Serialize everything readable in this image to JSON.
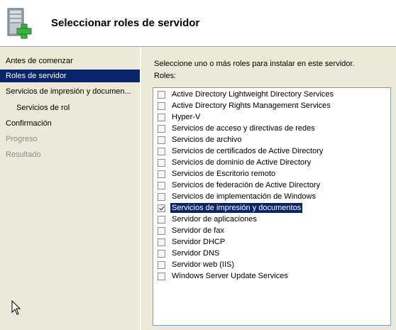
{
  "header": {
    "title": "Seleccionar roles de servidor",
    "icon": "server-add-icon"
  },
  "nav": {
    "items": [
      {
        "label": "Antes de comenzar",
        "state": "normal",
        "level": 0
      },
      {
        "label": "Roles de servidor",
        "state": "selected",
        "level": 0
      },
      {
        "label": "Servicios de impresión y documen...",
        "state": "normal",
        "level": 0
      },
      {
        "label": "Servicios de rol",
        "state": "normal",
        "level": 1
      },
      {
        "label": "Confirmación",
        "state": "normal",
        "level": 0
      },
      {
        "label": "Progreso",
        "state": "disabled",
        "level": 0
      },
      {
        "label": "Resultado",
        "state": "disabled",
        "level": 0
      }
    ]
  },
  "main": {
    "instruction": "Seleccione uno o más roles para instalar en este servidor.",
    "roles_label": "Roles:",
    "roles": [
      {
        "label": "Active Directory Lightweight Directory Services",
        "checked": false
      },
      {
        "label": "Active Directory Rights Management Services",
        "checked": false
      },
      {
        "label": "Hyper-V",
        "checked": false
      },
      {
        "label": "Servicios de acceso y directivas de redes",
        "checked": false
      },
      {
        "label": "Servicios de archivo",
        "checked": false
      },
      {
        "label": "Servicios de certificados de Active Directory",
        "checked": false
      },
      {
        "label": "Servicios de dominio de Active Directory",
        "checked": false
      },
      {
        "label": "Servicios de Escritorio remoto",
        "checked": false
      },
      {
        "label": "Servicios de federación de Active Directory",
        "checked": false
      },
      {
        "label": "Servicios de implementación de Windows",
        "checked": false
      },
      {
        "label": "Servicios de impresión y documentos",
        "checked": true,
        "highlighted": true
      },
      {
        "label": "Servidor de aplicaciones",
        "checked": false
      },
      {
        "label": "Servidor de fax",
        "checked": false
      },
      {
        "label": "Servidor DHCP",
        "checked": false
      },
      {
        "label": "Servidor DNS",
        "checked": false
      },
      {
        "label": "Servidor web (IIS)",
        "checked": false
      },
      {
        "label": "Windows Server Update Services",
        "checked": false
      }
    ]
  },
  "colors": {
    "selection": "#0a246a",
    "pane_background": "#ece9d8",
    "disabled_text": "#8c8c8c",
    "plus_green": "#3cb043"
  }
}
